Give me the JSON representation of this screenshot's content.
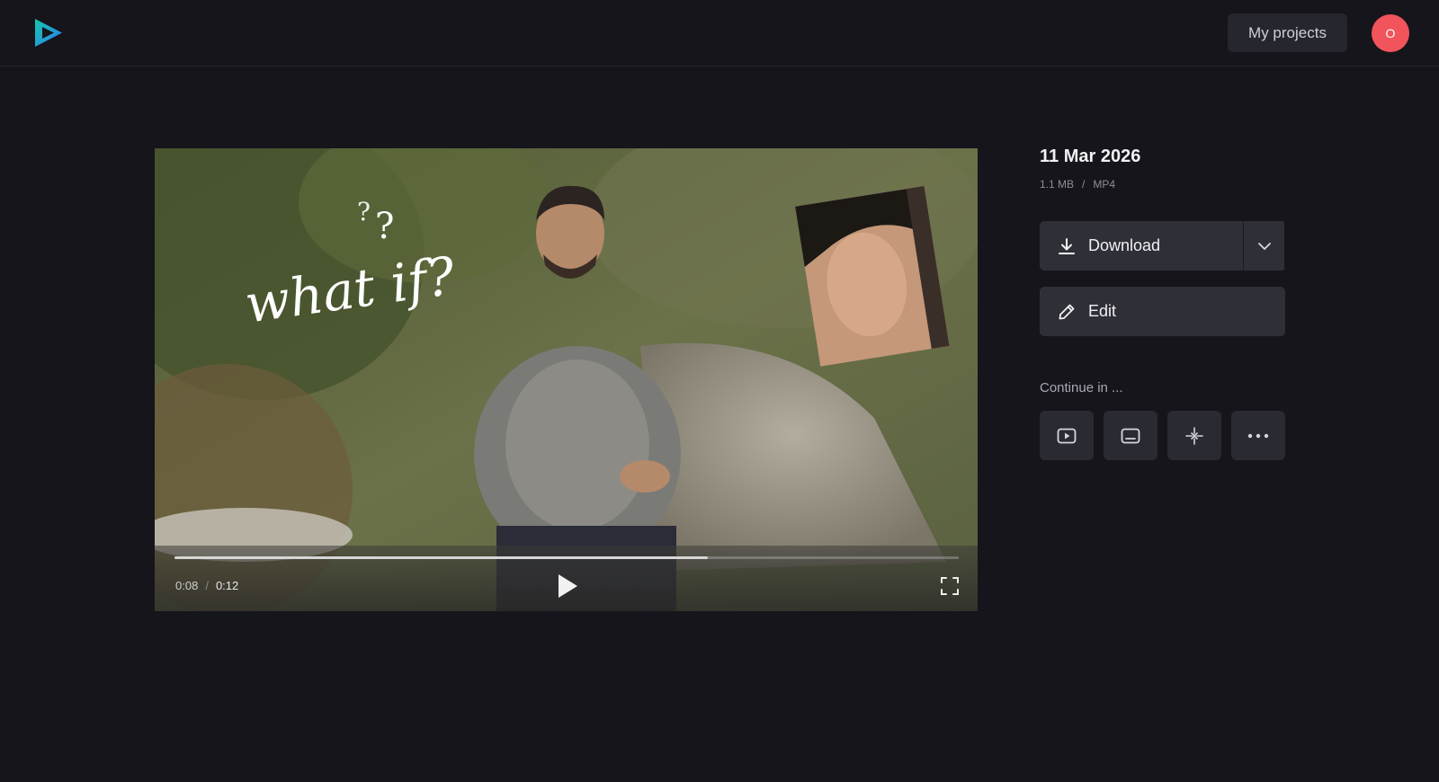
{
  "header": {
    "logo_icon": "play-triangle-logo",
    "my_projects_label": "My projects",
    "avatar_initial": "O",
    "avatar_color": "#f2545b"
  },
  "video": {
    "overlay_text": "what if?",
    "progress_fraction": 0.68,
    "current_time": "0:08",
    "time_separator": "/",
    "total_time": "0:12",
    "play_icon": "play-icon",
    "fullscreen_icon": "fullscreen-icon"
  },
  "details": {
    "date": "11 Mar 2026",
    "size": "1.1 MB",
    "meta_separator": "/",
    "format": "MP4"
  },
  "actions": {
    "download_label": "Download",
    "download_icon": "download-icon",
    "dropdown_icon": "chevron-down-icon",
    "edit_label": "Edit",
    "edit_icon": "pencil-icon"
  },
  "continue": {
    "label": "Continue in ...",
    "tools": [
      {
        "icon": "video-player-icon"
      },
      {
        "icon": "subtitles-icon"
      },
      {
        "icon": "sparkle-icon"
      },
      {
        "icon": "more-icon"
      }
    ]
  },
  "colors": {
    "background": "#15151b",
    "button": "#2f2f38",
    "accent_logo_blue": "#2f7cf6",
    "accent_logo_teal": "#16c6a8"
  }
}
